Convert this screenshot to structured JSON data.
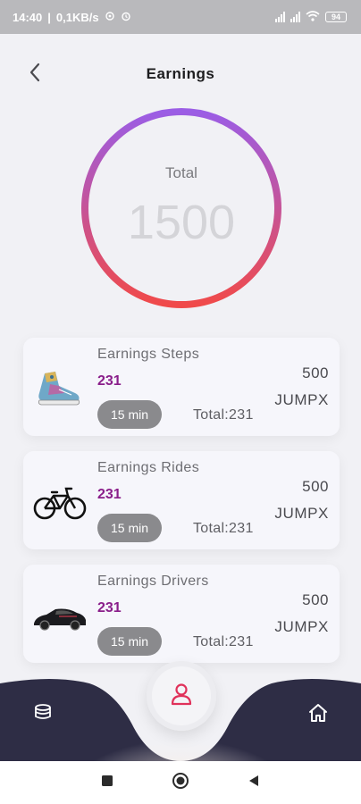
{
  "status_bar": {
    "time": "14:40",
    "network_speed": "0,1KB/s",
    "battery": "94"
  },
  "header": {
    "title": "Earnings",
    "back_icon": "chevron-left-icon"
  },
  "total": {
    "label": "Total",
    "value": "1500",
    "ring_colors": [
      "#9b5de5",
      "#f04a4a"
    ]
  },
  "cards": [
    {
      "title": "Earnings Steps",
      "value": "231",
      "time": "15 min",
      "total": "Total:231",
      "amount": "500",
      "unit": "JUMPX",
      "icon": "sneaker-icon"
    },
    {
      "title": "Earnings Rides",
      "value": "231",
      "time": "15 min",
      "total": "Total:231",
      "amount": "500",
      "unit": "JUMPX",
      "icon": "bicycle-icon"
    },
    {
      "title": "Earnings Drivers",
      "value": "231",
      "time": "15 min",
      "total": "Total:231",
      "amount": "500",
      "unit": "JUMPX",
      "icon": "car-icon"
    }
  ],
  "bottom_nav": {
    "left_icon": "coins-icon",
    "center_icon": "user-icon",
    "right_icon": "home-icon",
    "bar_color": "#2e2d45",
    "accent": "#e0315a"
  },
  "colors": {
    "value_purple": "#8a1e8a",
    "pill_gray": "#8a8a8d"
  }
}
